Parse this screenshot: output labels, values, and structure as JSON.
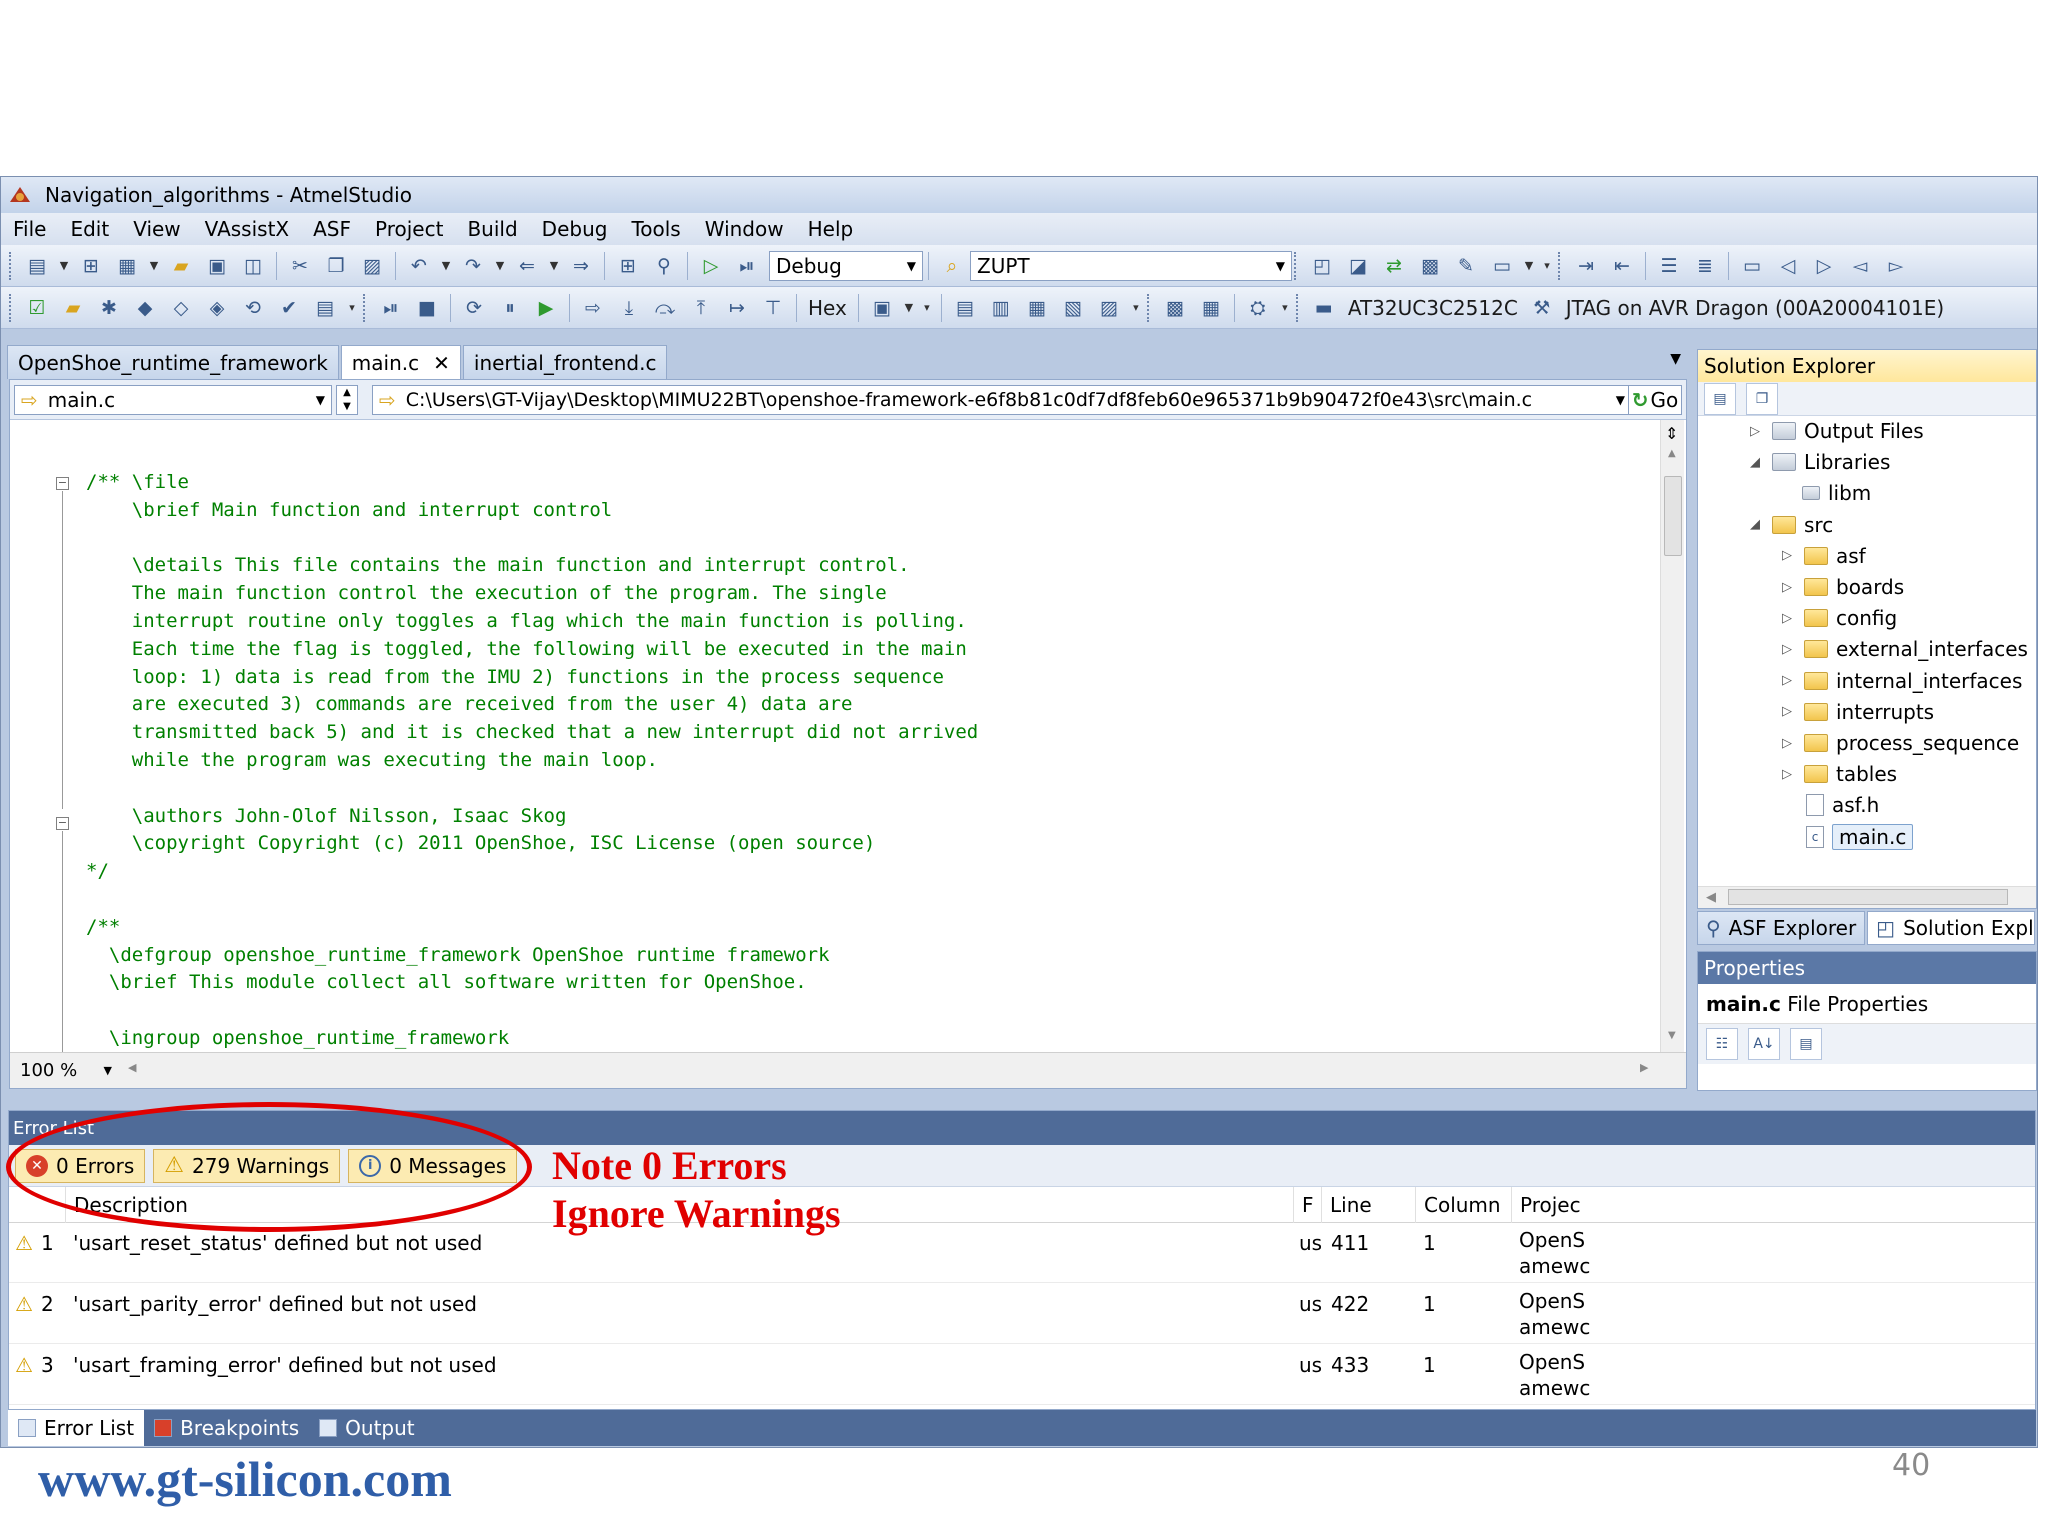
{
  "window": {
    "title": "Navigation_algorithms - AtmelStudio"
  },
  "menu": [
    "File",
    "Edit",
    "View",
    "VAssistX",
    "ASF",
    "Project",
    "Build",
    "Debug",
    "Tools",
    "Window",
    "Help"
  ],
  "toolbar": {
    "config_combo": "Debug",
    "search_combo": "ZUPT",
    "hex_label": "Hex",
    "device": "AT32UC3C2512C",
    "tool": "JTAG on AVR Dragon (00A20004101E)"
  },
  "tabs": [
    {
      "label": "OpenShoe_runtime_framework"
    },
    {
      "label": "main.c",
      "close": "✕"
    },
    {
      "label": "inertial_frontend.c"
    }
  ],
  "editor": {
    "file_combo": "main.c",
    "path": "C:\\Users\\GT-Vijay\\Desktop\\MIMU22BT\\openshoe-framework-e6f8b81c0df7df8feb60e965371b9b90472f0e43\\src\\main.c",
    "go_label": "Go",
    "zoom": "100 %",
    "code_lines": [
      "/** \\file",
      "    \\brief Main function and interrupt control",
      "",
      "    \\details This file contains the main function and interrupt control.",
      "    The main function control the execution of the program. The single",
      "    interrupt routine only toggles a flag which the main function is polling.",
      "    Each time the flag is toggled, the following will be executed in the main",
      "    loop: 1) data is read from the IMU 2) functions in the process sequence",
      "    are executed 3) commands are received from the user 4) data are",
      "    transmitted back 5) and it is checked that a new interrupt did not arrived",
      "    while the program was executing the main loop.",
      "",
      "    \\authors John-Olof Nilsson, Isaac Skog",
      "    \\copyright Copyright (c) 2011 OpenShoe, ISC License (open source)",
      "*/",
      "",
      "/**",
      "  \\defgroup openshoe_runtime_framework OpenShoe runtime framework",
      "  \\brief This module collect all software written for OpenShoe.",
      "",
      "  \\ingroup openshoe_runtime_framework"
    ]
  },
  "solution_explorer": {
    "title": "Solution Explorer",
    "nodes": [
      {
        "label": "Output Files",
        "expander": "▷",
        "icon": "folder-grey"
      },
      {
        "label": "Libraries",
        "expander": "◢",
        "icon": "folder-grey"
      },
      {
        "label": "libm",
        "expander": "",
        "icon": "library"
      },
      {
        "label": "src",
        "expander": "◢",
        "icon": "folder"
      },
      {
        "label": "asf",
        "expander": "▷",
        "icon": "folder"
      },
      {
        "label": "boards",
        "expander": "▷",
        "icon": "folder"
      },
      {
        "label": "config",
        "expander": "▷",
        "icon": "folder"
      },
      {
        "label": "external_interfaces",
        "expander": "▷",
        "icon": "folder"
      },
      {
        "label": "internal_interfaces",
        "expander": "▷",
        "icon": "folder"
      },
      {
        "label": "interrupts",
        "expander": "▷",
        "icon": "folder"
      },
      {
        "label": "process_sequence",
        "expander": "▷",
        "icon": "folder"
      },
      {
        "label": "tables",
        "expander": "▷",
        "icon": "folder"
      },
      {
        "label": "asf.h",
        "expander": "",
        "icon": "file"
      },
      {
        "label": "main.c",
        "expander": "",
        "icon": "c-file"
      }
    ],
    "tabs": [
      "ASF Explorer",
      "Solution Explo"
    ]
  },
  "properties": {
    "title": "Properties",
    "subject_name": "main.c",
    "subject_type": "File Properties"
  },
  "error_list": {
    "title": "Error List",
    "filters": {
      "errors": "0 Errors",
      "warnings": "279 Warnings",
      "messages": "0 Messages"
    },
    "columns": [
      "Description",
      "F",
      "Line",
      "Column",
      "Projec"
    ],
    "rows": [
      {
        "num": "1",
        "description": "'usart_reset_status' defined but not used",
        "file": "usa",
        "line": "411",
        "column": "1",
        "project": [
          "OpenS",
          "amewc"
        ]
      },
      {
        "num": "2",
        "description": "'usart_parity_error' defined but not used",
        "file": "usa",
        "line": "422",
        "column": "1",
        "project": [
          "OpenS",
          "amewc"
        ]
      },
      {
        "num": "3",
        "description": "'usart_framing_error' defined but not used",
        "file": "usa",
        "line": "433",
        "column": "1",
        "project": [
          "OpenS",
          "amewc"
        ]
      }
    ]
  },
  "bottom_tabs": [
    "Error List",
    "Breakpoints",
    "Output"
  ],
  "annotation": {
    "line1": "Note 0 Errors",
    "line2": "Ignore Warnings",
    "color": "#e00000"
  },
  "footer": {
    "website": "www.gt-silicon.com",
    "page_number": "40"
  }
}
